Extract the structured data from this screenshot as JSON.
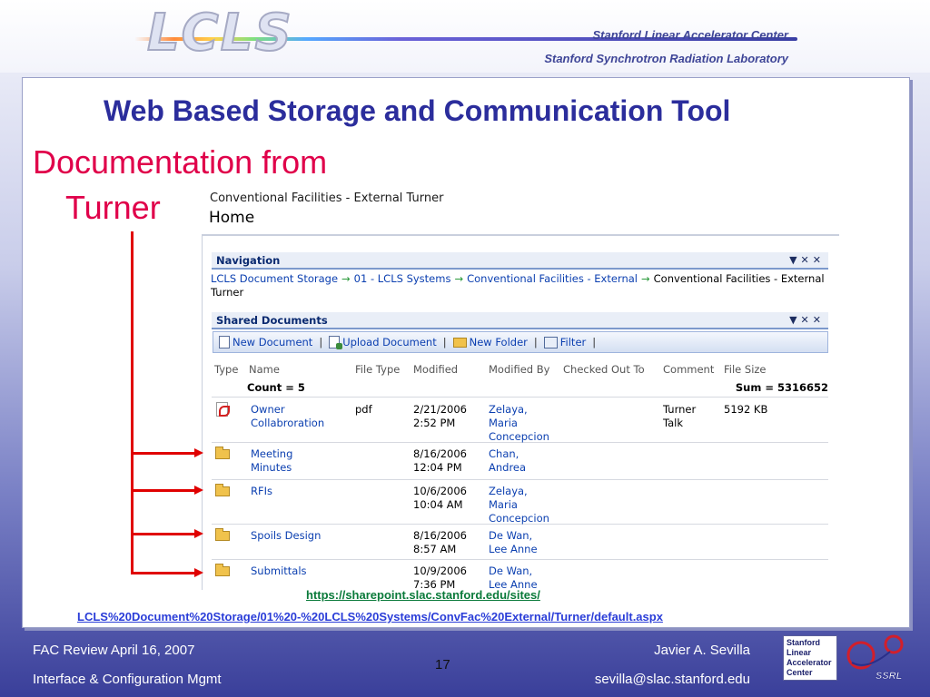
{
  "header": {
    "logo_text": "LCLS",
    "org_line_1": "Stanford Linear Accelerator Center",
    "org_line_2": "Stanford Synchrotron Radiation Laboratory"
  },
  "slide": {
    "title": "Web Based Storage and Communication Tool",
    "subtitle_line_1": "Documentation from",
    "subtitle_line_2": "Turner"
  },
  "sharepoint": {
    "site_name": "Conventional Facilities - External Turner",
    "page_title": "Home",
    "navigation": {
      "title": "Navigation",
      "breadcrumb": [
        "LCLS Document Storage",
        "01 - LCLS Systems",
        "Conventional Facilities - External"
      ],
      "current": "Conventional Facilities - External Turner"
    },
    "shared_documents": {
      "title": "Shared Documents",
      "toolbar": {
        "new_document": "New Document",
        "upload_document": "Upload Document",
        "new_folder": "New Folder",
        "filter": "Filter"
      },
      "columns": {
        "type": "Type",
        "name": "Name",
        "file_type": "File Type",
        "modified": "Modified",
        "modified_by": "Modified By",
        "checked_out_to": "Checked Out To",
        "comment": "Comment",
        "file_size": "File Size"
      },
      "count_label": "Count = 5",
      "sum_label": "Sum = 5316652",
      "rows": [
        {
          "icon": "pdf-icon",
          "name": "Owner\nCollabroration",
          "file_type": "pdf",
          "modified": "2/21/2006\n2:52 PM",
          "modified_by": "Zelaya,\nMaria\nConcepcion",
          "comment": "Turner\nTalk",
          "file_size": "5192 KB"
        },
        {
          "icon": "folder-icon",
          "name": "Meeting\nMinutes",
          "file_type": "",
          "modified": "8/16/2006\n12:04 PM",
          "modified_by": "Chan,\nAndrea",
          "comment": "",
          "file_size": ""
        },
        {
          "icon": "folder-icon",
          "name": "RFIs",
          "file_type": "",
          "modified": "10/6/2006\n10:04 AM",
          "modified_by": "Zelaya,\nMaria\nConcepcion",
          "comment": "",
          "file_size": ""
        },
        {
          "icon": "folder-icon",
          "name": "Spoils Design",
          "file_type": "",
          "modified": "8/16/2006\n8:57 AM",
          "modified_by": "De Wan,\nLee Anne",
          "comment": "",
          "file_size": ""
        },
        {
          "icon": "folder-icon",
          "name": "Submittals",
          "file_type": "",
          "modified": "10/9/2006\n7:36 PM",
          "modified_by": "De Wan,\nLee Anne",
          "comment": "",
          "file_size": ""
        }
      ]
    }
  },
  "links": {
    "url_line_1": "https://sharepoint.slac.stanford.edu/sites/",
    "url_line_2": "LCLS%20Document%20Storage/01%20-%20LCLS%20Systems/ConvFac%20External/Turner/default.aspx"
  },
  "footer": {
    "left_1": "FAC Review April 16, 2007",
    "left_2": "Interface & Configuration Mgmt",
    "page_number": "17",
    "right_1": "Javier A. Sevilla",
    "right_2": "sevilla@slac.stanford.edu"
  },
  "ssrl_logo": {
    "lines": [
      "Stanford",
      "Linear",
      "Accelerator",
      "Center"
    ],
    "mark": "SSRL"
  },
  "colors": {
    "title_blue": "#2b2d9c",
    "subtitle_red": "#e0004a",
    "link_blue": "#0b3fb0",
    "annotation_red": "#e00000"
  }
}
